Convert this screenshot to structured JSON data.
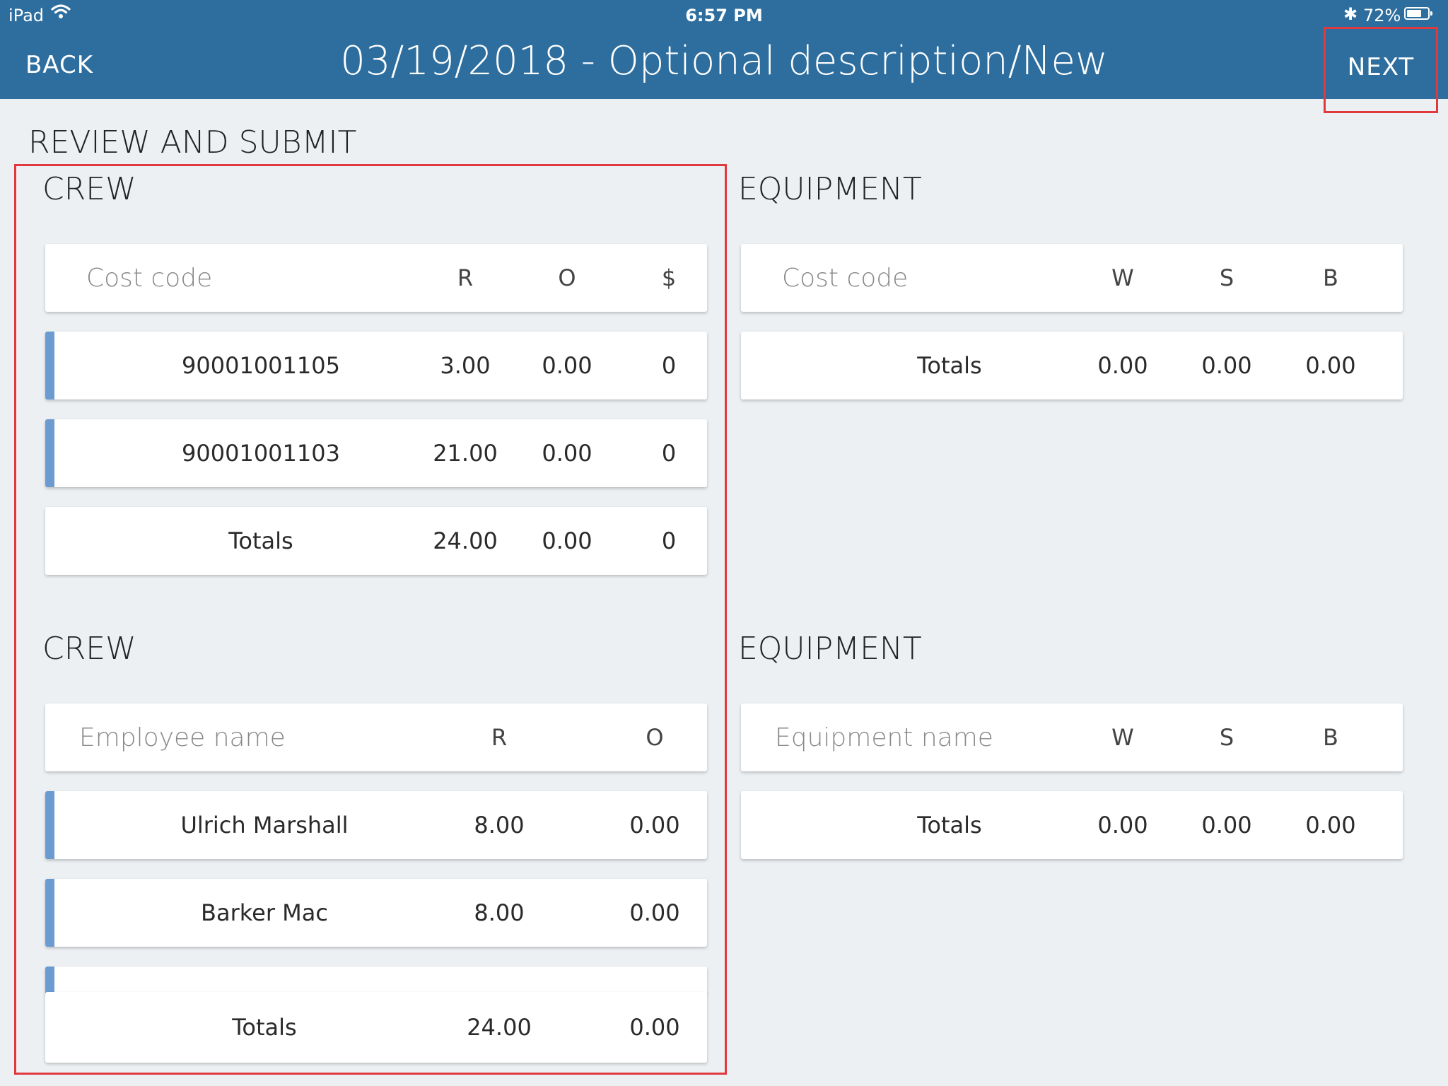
{
  "status_bar": {
    "device": "iPad",
    "time": "6:57 PM",
    "battery": "72%",
    "battery_level": 0.72
  },
  "nav": {
    "back_label": "BACK",
    "title": "03/19/2018 - Optional description/New",
    "next_label": "NEXT"
  },
  "page_title": "REVIEW AND SUBMIT",
  "crew_cost": {
    "title": "CREW",
    "headers": [
      "Cost code",
      "R",
      "O",
      "$"
    ],
    "rows": [
      [
        "90001001105",
        "3.00",
        "0.00",
        "0"
      ],
      [
        "90001001103",
        "21.00",
        "0.00",
        "0"
      ]
    ],
    "totals": [
      "Totals",
      "24.00",
      "0.00",
      "0"
    ]
  },
  "equipment_cost": {
    "title": "EQUIPMENT",
    "headers": [
      "Cost code",
      "W",
      "S",
      "B"
    ],
    "totals": [
      "Totals",
      "0.00",
      "0.00",
      "0.00"
    ]
  },
  "crew_employees": {
    "title": "CREW",
    "headers": [
      "Employee name",
      "R",
      "O"
    ],
    "rows": [
      [
        "Ulrich Marshall",
        "8.00",
        "0.00"
      ],
      [
        "Barker Mac",
        "8.00",
        "0.00"
      ]
    ],
    "totals": [
      "Totals",
      "24.00",
      "0.00"
    ]
  },
  "equipment_names": {
    "title": "EQUIPMENT",
    "headers": [
      "Equipment name",
      "W",
      "S",
      "B"
    ],
    "totals": [
      "Totals",
      "0.00",
      "0.00",
      "0.00"
    ]
  }
}
